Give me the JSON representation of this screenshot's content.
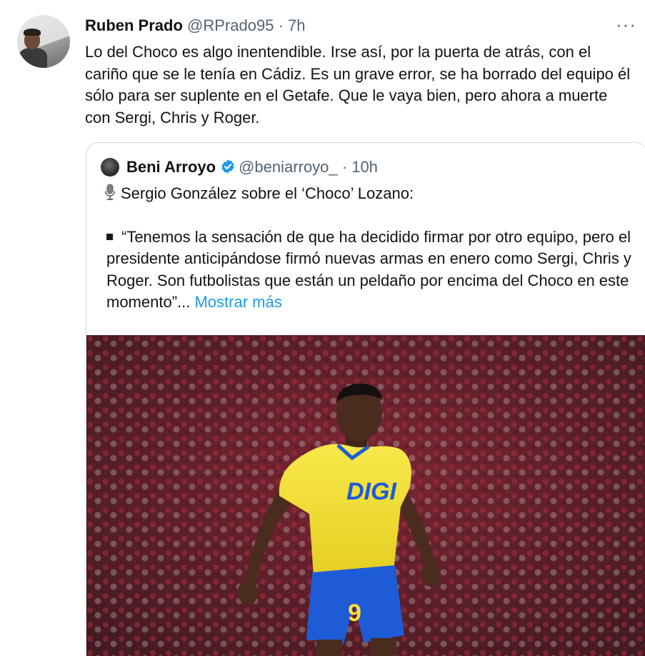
{
  "tweet": {
    "author_name": "Ruben Prado",
    "author_handle": "@RPrado95",
    "separator": "·",
    "time": "7h",
    "more_label": "···",
    "text": "Lo del Choco es algo inentendible. Irse así, por la puerta de atrás, con el cariño que se le tenía en Cádiz. Es un grave error, se ha borrado del equipo él sólo para ser suplente en el Getafe. Que le vaya bien, pero ahora a muerte con Sergi, Chris y Roger."
  },
  "quote": {
    "author_name": "Beni Arroyo",
    "author_handle": "@beniarroyo_",
    "separator": "·",
    "time": "10h",
    "line1": "Sergio González sobre el ‘Choco’ Lozano:",
    "line2": "“Tenemos la sensación de que ha decidido firmar por otro equipo, pero el presidente anticipándose firmó nuevas armas en enero como Sergi, Chris y Roger. Son futbolistas que están un peldaño por encima del Choco en este momento”...",
    "show_more": "Mostrar más",
    "image": {
      "sponsor": "DIGI",
      "number": "9",
      "shirt_color": "#f4e13a",
      "shorts_color": "#1e5bd6",
      "crowd_color": "#b0243a"
    }
  },
  "colors": {
    "text": "#0f1419",
    "secondary": "#536471",
    "link": "#1d9bf0",
    "border": "#cfd9de"
  }
}
